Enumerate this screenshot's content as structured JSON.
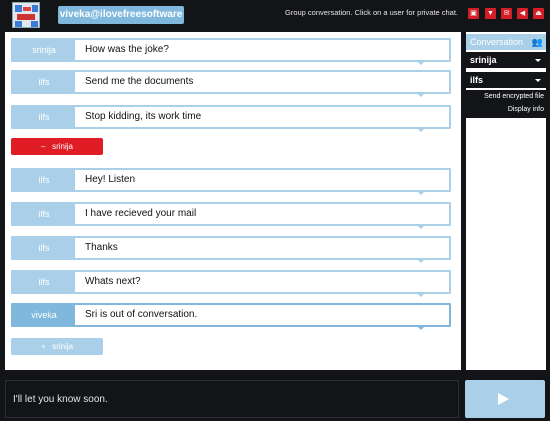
{
  "header": {
    "username": "viveka@ilovefreesoftware",
    "hint": "Group conversation. Click on a user for private chat.",
    "tools": [
      {
        "name": "image-icon",
        "glyph": "▣"
      },
      {
        "name": "filter-icon",
        "glyph": "▼"
      },
      {
        "name": "chat-icon",
        "glyph": "✉"
      },
      {
        "name": "sound-icon",
        "glyph": "◀"
      },
      {
        "name": "eject-icon",
        "glyph": "⏏"
      }
    ]
  },
  "messages": [
    {
      "user": "srinija",
      "text": "How was the joke?"
    },
    {
      "user": "ilfs",
      "text": "Send me the documents"
    },
    {
      "user": "ilfs",
      "text": "Stop kidding, its work time"
    },
    {
      "user": "ilfs",
      "text": "Hey! Listen"
    },
    {
      "user": "ilfs",
      "text": "I have recieved your mail"
    },
    {
      "user": "ilfs",
      "text": "Thanks"
    },
    {
      "user": "ilfs",
      "text": "Whats next?"
    },
    {
      "user": "viveka",
      "text": "Sri is out of conversation."
    }
  ],
  "status_events": {
    "left": {
      "icon": "–",
      "user": "srinija"
    },
    "joined": {
      "icon": "+",
      "user": "srinija"
    }
  },
  "sidebar": {
    "title": "Conversation",
    "users": [
      "srinija",
      "ilfs"
    ],
    "menu": [
      "Send encrypted file",
      "Display info"
    ]
  },
  "composer": {
    "text": "I'll let you know soon."
  },
  "colors": {
    "accent": "#a9d0e8",
    "self_accent": "#7fb8dc",
    "alert": "#e01c24",
    "background": "#121418"
  }
}
